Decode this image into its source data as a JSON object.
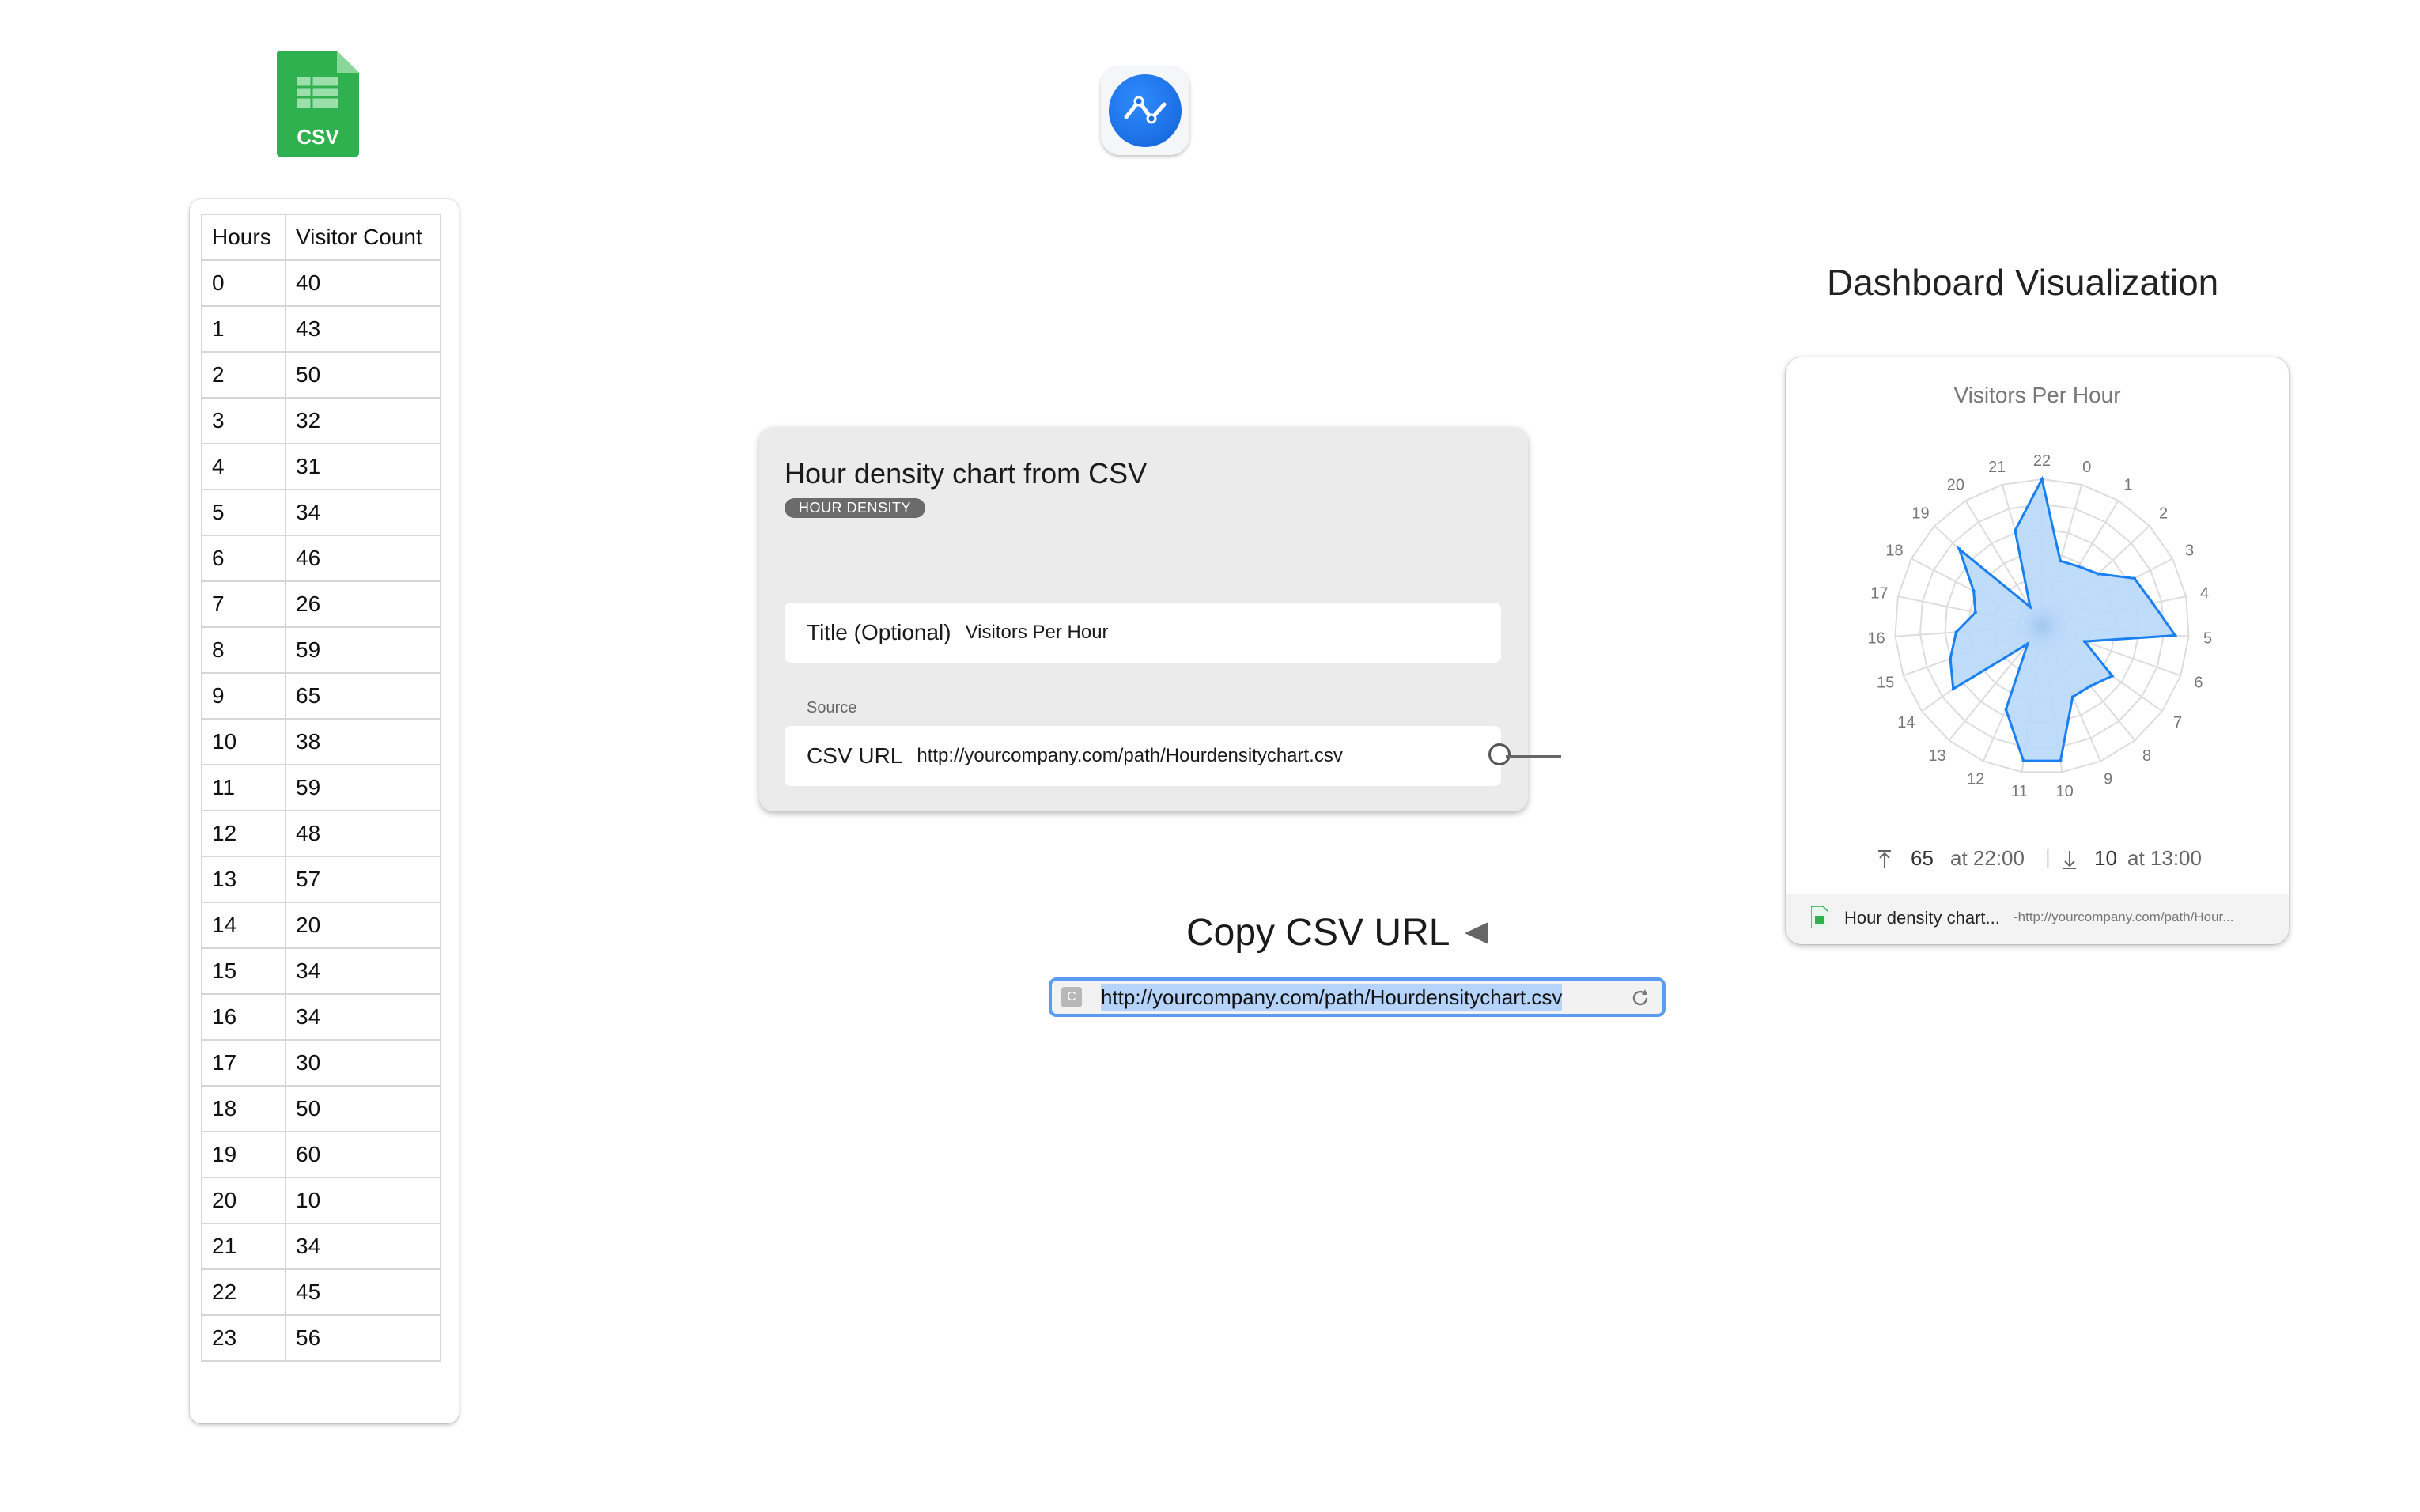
{
  "file_badge": "CSV",
  "table": {
    "headers": [
      "Hours",
      "Visitor Count"
    ],
    "rows": [
      [
        "0",
        "40"
      ],
      [
        "1",
        "43"
      ],
      [
        "2",
        "50"
      ],
      [
        "3",
        "32"
      ],
      [
        "4",
        "31"
      ],
      [
        "5",
        "34"
      ],
      [
        "6",
        "46"
      ],
      [
        "7",
        "26"
      ],
      [
        "8",
        "59"
      ],
      [
        "9",
        "65"
      ],
      [
        "10",
        "38"
      ],
      [
        "11",
        "59"
      ],
      [
        "12",
        "48"
      ],
      [
        "13",
        "57"
      ],
      [
        "14",
        "20"
      ],
      [
        "15",
        "34"
      ],
      [
        "16",
        "34"
      ],
      [
        "17",
        "30"
      ],
      [
        "18",
        "50"
      ],
      [
        "19",
        "60"
      ],
      [
        "20",
        "10"
      ],
      [
        "21",
        "34"
      ],
      [
        "22",
        "45"
      ],
      [
        "23",
        "56"
      ]
    ]
  },
  "config": {
    "title": "Hour density chart from CSV",
    "badge": "HOUR DENSITY",
    "title_field": {
      "label": "Title (Optional)",
      "value": "Visitors Per Hour"
    },
    "source_section": "Source",
    "csv_field": {
      "label": "CSV URL",
      "value": "http://yourcompany.com/path/Hourdensitychart.csv"
    }
  },
  "copy": {
    "label": "Copy CSV URL",
    "favicon": "C",
    "url": "http://yourcompany.com/path/Hourdensitychart.csv"
  },
  "dashboard": {
    "heading": "Dashboard Visualization",
    "max_value": "65",
    "max_time": "at 22:00",
    "min_value": "10",
    "min_time": "at 13:00",
    "footer_name": "Hour density chart...",
    "footer_url": "-http://yourcompany.com/path/Hour..."
  },
  "chart_data": {
    "type": "radar",
    "title": "Visitors Per Hour",
    "hour_labels_clockwise": [
      "22",
      "0",
      "1",
      "2",
      "3",
      "4",
      "5",
      "6",
      "7",
      "8",
      "9",
      "10",
      "11",
      "12",
      "13",
      "14",
      "15",
      "16",
      "17",
      "18",
      "19",
      "20",
      "21"
    ],
    "points": [
      {
        "label": "22",
        "value": 65
      },
      {
        "label": "0",
        "value": 30
      },
      {
        "label": "1",
        "value": 31
      },
      {
        "label": "2",
        "value": 34
      },
      {
        "label": "3",
        "value": 46
      },
      {
        "label": "4",
        "value": 50
      },
      {
        "label": "5",
        "value": 59
      },
      {
        "label": "6",
        "value": 20
      },
      {
        "label": "7",
        "value": 38
      },
      {
        "label": "8",
        "value": 34
      },
      {
        "label": "9",
        "value": 34
      },
      {
        "label": "10",
        "value": 60
      },
      {
        "label": "11",
        "value": 60
      },
      {
        "label": "12",
        "value": 40
      },
      {
        "label": "13",
        "value": 10
      },
      {
        "label": "14",
        "value": 48
      },
      {
        "label": "15",
        "value": 43
      },
      {
        "label": "16",
        "value": 38
      },
      {
        "label": "17",
        "value": 30
      },
      {
        "label": "18",
        "value": 34
      },
      {
        "label": "19",
        "value": 50
      },
      {
        "label": "20",
        "value": 10
      },
      {
        "label": "21",
        "value": 44
      }
    ],
    "rmax": 65,
    "grid": true,
    "colors": {
      "fill": "#b9d8fb",
      "stroke": "#1a7ff0",
      "grid": "#dddddd"
    }
  }
}
